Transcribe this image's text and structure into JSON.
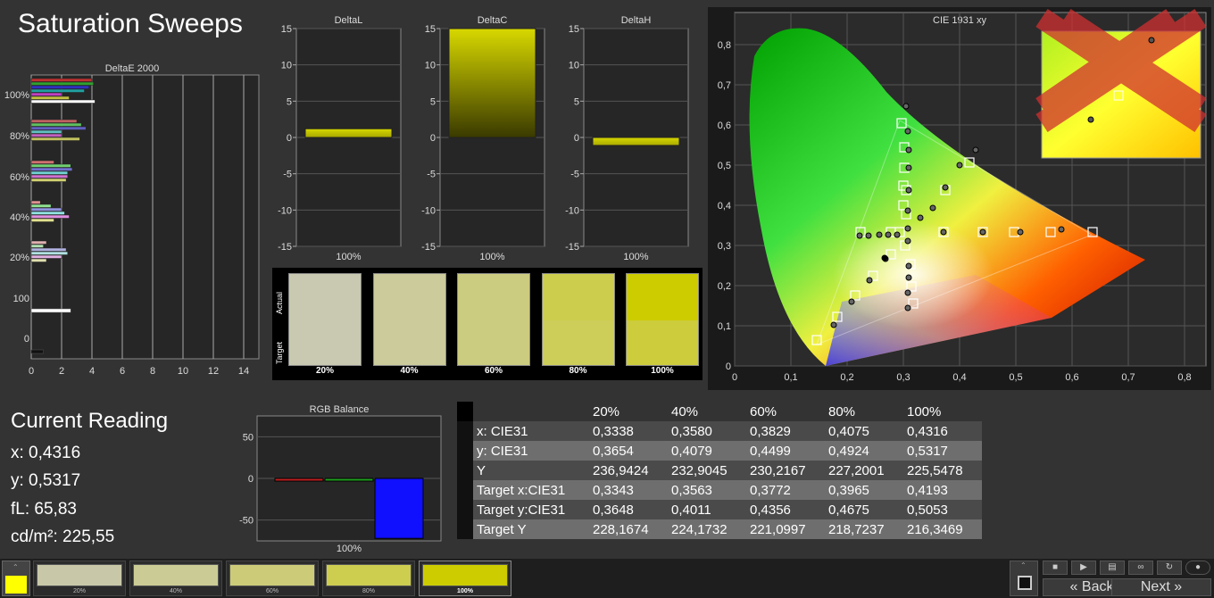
{
  "title": "Saturation Sweeps",
  "deltae": {
    "title": "DeltaE 2000",
    "ylabels": [
      "100%",
      "80%",
      "60%",
      "40%",
      "20%",
      "100",
      "0"
    ],
    "xticks": [
      "0",
      "2",
      "4",
      "6",
      "8",
      "10",
      "12",
      "14"
    ]
  },
  "small_charts": [
    {
      "title": "DeltaL",
      "value": 1.2,
      "xlabel": "100%"
    },
    {
      "title": "DeltaC",
      "value": 15,
      "xlabel": "100%"
    },
    {
      "title": "DeltaH",
      "value": -1.1,
      "xlabel": "100%"
    }
  ],
  "small_ticks": [
    "15",
    "10",
    "5",
    "0",
    "-5",
    "-10",
    "-15"
  ],
  "swatches": {
    "actual_label": "Actual",
    "target_label": "Target",
    "items": [
      {
        "label": "20%",
        "actual": "#c9c9b1",
        "target": "#c9c9b1"
      },
      {
        "label": "40%",
        "actual": "#cbcb9c",
        "target": "#cbcb9c"
      },
      {
        "label": "60%",
        "actual": "#cccc80",
        "target": "#cccc80"
      },
      {
        "label": "80%",
        "actual": "#cdcd4d",
        "target": "#cdcd5a"
      },
      {
        "label": "100%",
        "actual": "#cccc00",
        "target": "#cccc3c"
      }
    ]
  },
  "cie": {
    "title": "CIE 1931 xy",
    "xticks": [
      "0",
      "0,1",
      "0,2",
      "0,3",
      "0,4",
      "0,5",
      "0,6",
      "0,7",
      "0,8"
    ],
    "yticks": [
      "0",
      "0,1",
      "0,2",
      "0,3",
      "0,4",
      "0,5",
      "0,6",
      "0,7",
      "0,8"
    ]
  },
  "current": {
    "title": "Current Reading",
    "x": "x: 0,4316",
    "y": "y: 0,5317",
    "fl": "fL: 65,83",
    "cd": "cd/m²: 225,55"
  },
  "rgb": {
    "title": "RGB Balance",
    "ticks": [
      "50",
      "0",
      "-50"
    ],
    "xlabel": "100%",
    "values": {
      "red": -2,
      "green": -2,
      "blue": -72
    }
  },
  "table": {
    "headers": [
      "",
      "20%",
      "40%",
      "60%",
      "80%",
      "100%"
    ],
    "rows": [
      [
        "x: CIE31",
        "0,3338",
        "0,3580",
        "0,3829",
        "0,4075",
        "0,4316"
      ],
      [
        "y: CIE31",
        "0,3654",
        "0,4079",
        "0,4499",
        "0,4924",
        "0,5317"
      ],
      [
        "Y",
        "236,9424",
        "232,9045",
        "230,2167",
        "227,2001",
        "225,5478"
      ],
      [
        "Target x:CIE31",
        "0,3343",
        "0,3563",
        "0,3772",
        "0,3965",
        "0,4193"
      ],
      [
        "Target y:CIE31",
        "0,3648",
        "0,4011",
        "0,4356",
        "0,4675",
        "0,5053"
      ],
      [
        "Target Y",
        "228,1674",
        "224,1732",
        "221,0997",
        "218,7237",
        "216,3469"
      ]
    ]
  },
  "bottom": {
    "thumbs": [
      {
        "label": "20%",
        "color": "#c8c8a8"
      },
      {
        "label": "40%",
        "color": "#cbcb95"
      },
      {
        "label": "60%",
        "color": "#cccc78"
      },
      {
        "label": "80%",
        "color": "#cdcd50"
      },
      {
        "label": "100%",
        "color": "#cccc00"
      }
    ],
    "back": "Back",
    "next": "Next",
    "current_color": "#ffff00"
  }
}
